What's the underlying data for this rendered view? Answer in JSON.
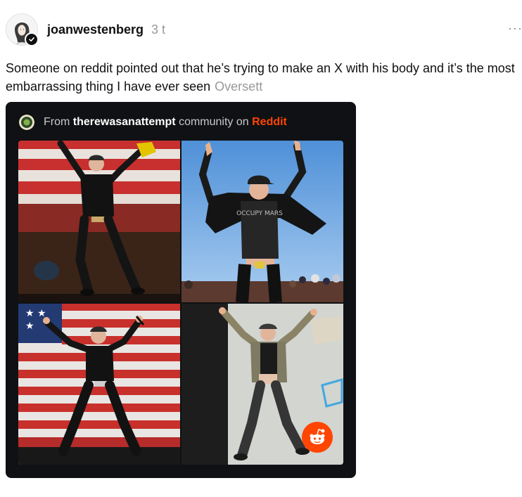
{
  "post": {
    "author": {
      "username": "joanwestenberg",
      "verified_icon": "checkmark-icon",
      "avatar_icon": "avatar-illustration"
    },
    "timestamp": "3 t",
    "more_icon": "more-options-icon",
    "more_label": "···",
    "text": "Someone on reddit pointed out that he’s trying to make an X with his body and it’s the most embarrassing thing I have ever seen",
    "translate_label": "Oversett"
  },
  "embed": {
    "source_prefix": "From",
    "community": "therewasanattempt",
    "source_middle": "community on",
    "platform": "Reddit",
    "platform_color": "#ff4500",
    "community_icon": "community-badge-icon",
    "badge_icon": "reddit-snoo-icon",
    "photos": [
      {
        "name": "photo-top-left",
        "description_icon": "person-jumping-stage-icon",
        "shirt_text": ""
      },
      {
        "name": "photo-top-right",
        "description_icon": "person-jumping-sky-icon",
        "shirt_text": "OCCUPY MARS"
      },
      {
        "name": "photo-bottom-left",
        "description_icon": "person-x-pose-flag-icon",
        "shirt_text": ""
      },
      {
        "name": "photo-bottom-right",
        "description_icon": "person-x-pose-stage-icon",
        "shirt_text": ""
      }
    ]
  },
  "colors": {
    "text": "#101010",
    "muted": "#999999",
    "embed_bg": "#0f1114",
    "reddit": "#ff4500"
  }
}
